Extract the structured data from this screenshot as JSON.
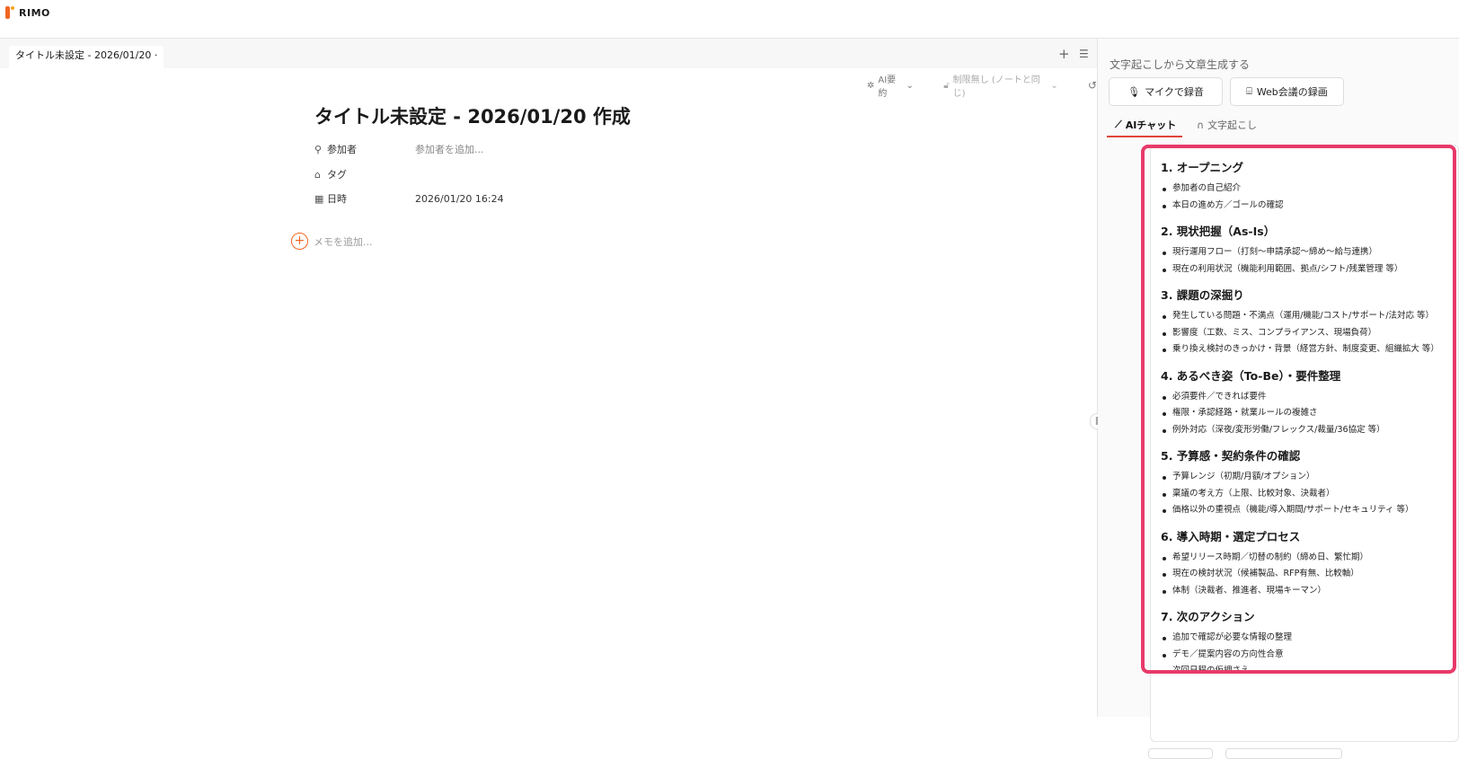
{
  "app": {
    "logo_text": "RIMO"
  },
  "tabs": {
    "active_label": "タイトル未設定 - 2026/01/20 ·",
    "add_icon": "plus-icon",
    "list_icon": "list-icon"
  },
  "toolbar": {
    "ai_summary_label": "AI要約",
    "permission_label": "制限無し (ノートと同じ)",
    "history_icon": "history-icon"
  },
  "note": {
    "title": "タイトル未設定 - 2026/01/20 作成",
    "participants_label": "参加者",
    "participants_placeholder": "参加者を追加...",
    "tag_label": "タグ",
    "datetime_label": "日時",
    "datetime_value": "2026/01/20 16:24",
    "memo_placeholder": "メモを追加..."
  },
  "panel": {
    "generate_label": "文字起こしから文章生成する",
    "mic_button": "マイクで録音",
    "web_button": "Web会議の録画",
    "tab_ai_chat": "AIチャット",
    "tab_transcript": "文字起こし",
    "sections": [
      {
        "heading": "1. オープニング",
        "items": [
          "参加者の自己紹介",
          "本日の進め方／ゴールの確認"
        ]
      },
      {
        "heading": "2. 現状把握（As-Is）",
        "items": [
          "現行運用フロー（打刻〜申請承認〜締め〜給与連携）",
          "現在の利用状況（機能利用範囲、拠点/シフト/残業管理 等）"
        ]
      },
      {
        "heading": "3. 課題の深掘り",
        "items": [
          "発生している問題・不満点（運用/機能/コスト/サポート/法対応 等）",
          "影響度（工数、ミス、コンプライアンス、現場負荷）",
          "乗り換え検討のきっかけ・背景（経営方針、制度変更、組織拡大 等）"
        ]
      },
      {
        "heading": "4. あるべき姿（To-Be）・要件整理",
        "items": [
          "必須要件／できれば要件",
          "権限・承認経路・就業ルールの複雑さ",
          "例外対応（深夜/変形労働/フレックス/裁量/36協定 等）"
        ]
      },
      {
        "heading": "5. 予算感・契約条件の確認",
        "items": [
          "予算レンジ（初期/月額/オプション）",
          "稟議の考え方（上限、比較対象、決裁者）",
          "価格以外の重視点（機能/導入期間/サポート/セキュリティ 等）"
        ]
      },
      {
        "heading": "6. 導入時期・選定プロセス",
        "items": [
          "希望リリース時期／切替の制約（締め日、繁忙期）",
          "現在の検討状況（候補製品、RFP有無、比較軸）",
          "体制（決裁者、推進者、現場キーマン）"
        ]
      },
      {
        "heading": "7. 次のアクション",
        "items": [
          "追加で確認が必要な情報の整理",
          "デモ／提案内容の方向性合意",
          "次回日程の仮押さえ"
        ]
      }
    ]
  },
  "colors": {
    "accent": "#f26522",
    "tab_underline": "#e0463a",
    "highlight": "#e83a6a"
  }
}
